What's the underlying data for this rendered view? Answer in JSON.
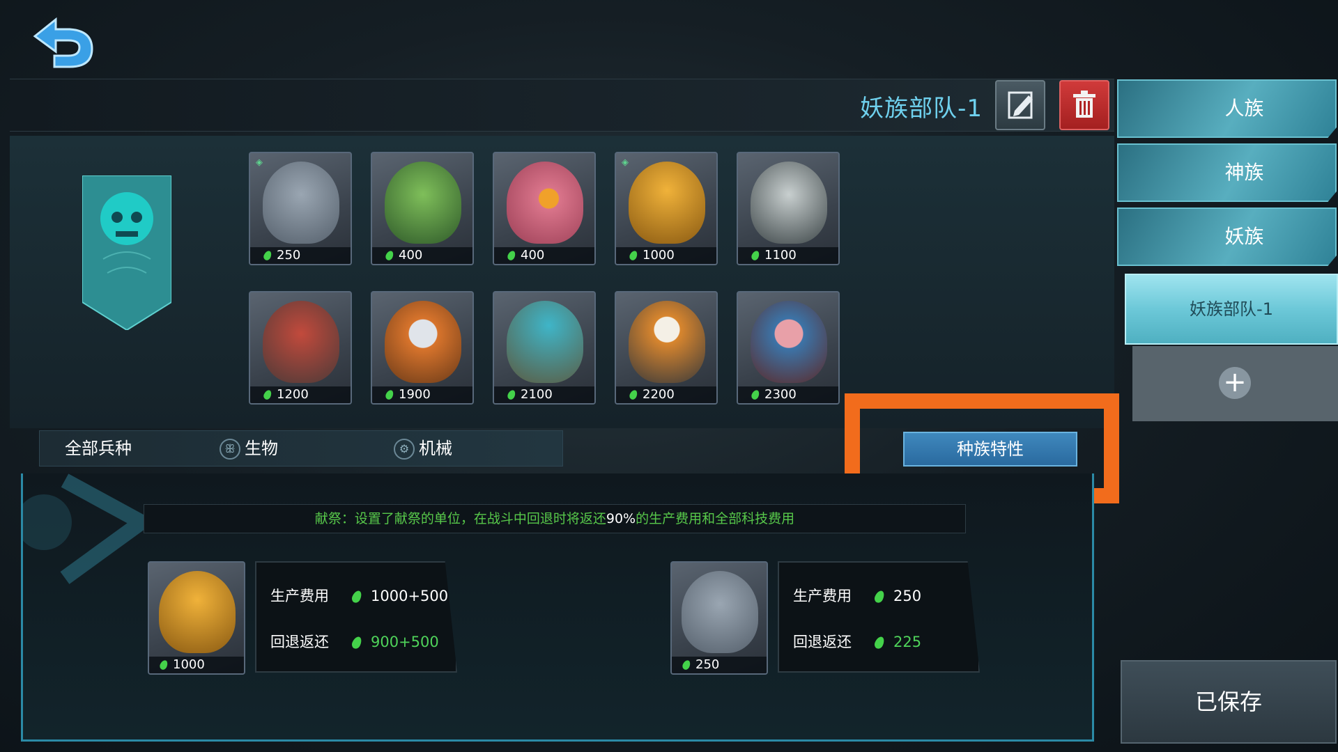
{
  "deck": {
    "title": "妖族部队-1"
  },
  "units": [
    {
      "cost": "250",
      "color": "#7c8a99"
    },
    {
      "cost": "400",
      "color": "#4f8a3d"
    },
    {
      "cost": "400",
      "color": "#c9687e"
    },
    {
      "cost": "1000",
      "color": "#d49a1e"
    },
    {
      "cost": "1100",
      "color": "#5d6a6e"
    },
    {
      "cost": "1200",
      "color": "#a2423a"
    },
    {
      "cost": "1900",
      "color": "#c76b2e"
    },
    {
      "cost": "2100",
      "color": "#3f7f8a"
    },
    {
      "cost": "2200",
      "color": "#cc7a2e"
    },
    {
      "cost": "2300",
      "color": "#3c6f9a"
    }
  ],
  "filters": {
    "all": "全部兵种",
    "bio": "生物",
    "mech": "机械"
  },
  "trait_button": "种族特性",
  "races": {
    "human": "人族",
    "god": "神族",
    "demon": "妖族"
  },
  "deck_list": {
    "item": "妖族部队-1"
  },
  "saved_label": "已保存",
  "trait": {
    "prefix": "献祭：设置了献祭的单位，在战斗中回退时将返还",
    "percent": "90%",
    "suffix": "的生产费用和全部科技费用"
  },
  "examples": [
    {
      "card_cost": "1000",
      "prod_label": "生产费用",
      "prod_value": "1000+500",
      "refund_label": "回退返还",
      "refund_value": "900+500",
      "color": "#d49a1e"
    },
    {
      "card_cost": "250",
      "prod_label": "生产费用",
      "prod_value": "250",
      "refund_label": "回退返还",
      "refund_value": "225",
      "color": "#7c8a99"
    }
  ]
}
